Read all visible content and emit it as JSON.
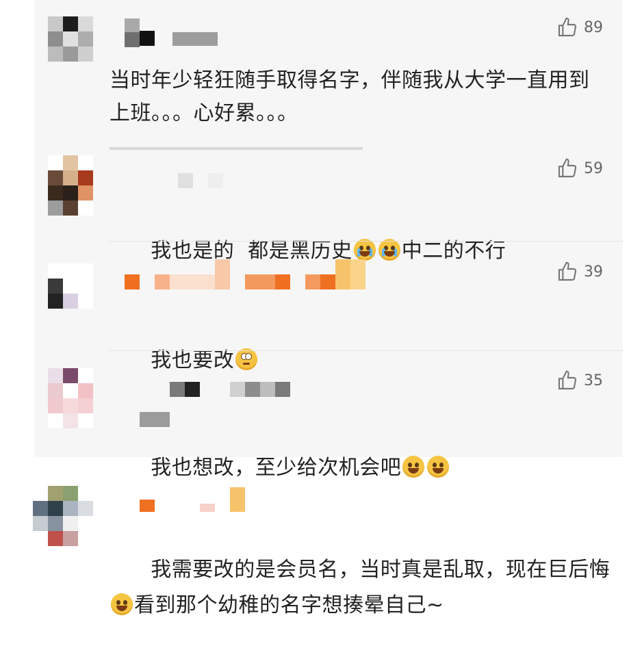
{
  "colors": {
    "panel_bg": "#f6f6f6",
    "text": "#222222",
    "meta": "#666666"
  },
  "comments": [
    {
      "text": "当时年少轻狂随手取得名字，伴随我从大学一直用到上班。。。心好累。。。",
      "likes": "89"
    },
    {
      "text_a": "我也是的  都是黑历史",
      "emoji_a": "crying-face",
      "text_b": "中二的不行",
      "likes": "59"
    },
    {
      "text": "我也要改",
      "emoji": "eye-roll-face",
      "likes": "39"
    },
    {
      "text": "我也想改，至少给次机会吧",
      "emoji": "laughing-face",
      "likes": "35"
    },
    {
      "text_a": "我需要改的是会员名，当时真是乱取，现在巨后悔",
      "emoji": "laughing-face",
      "text_b": "看到那个幼稚的名字想揍晕自己~"
    }
  ]
}
